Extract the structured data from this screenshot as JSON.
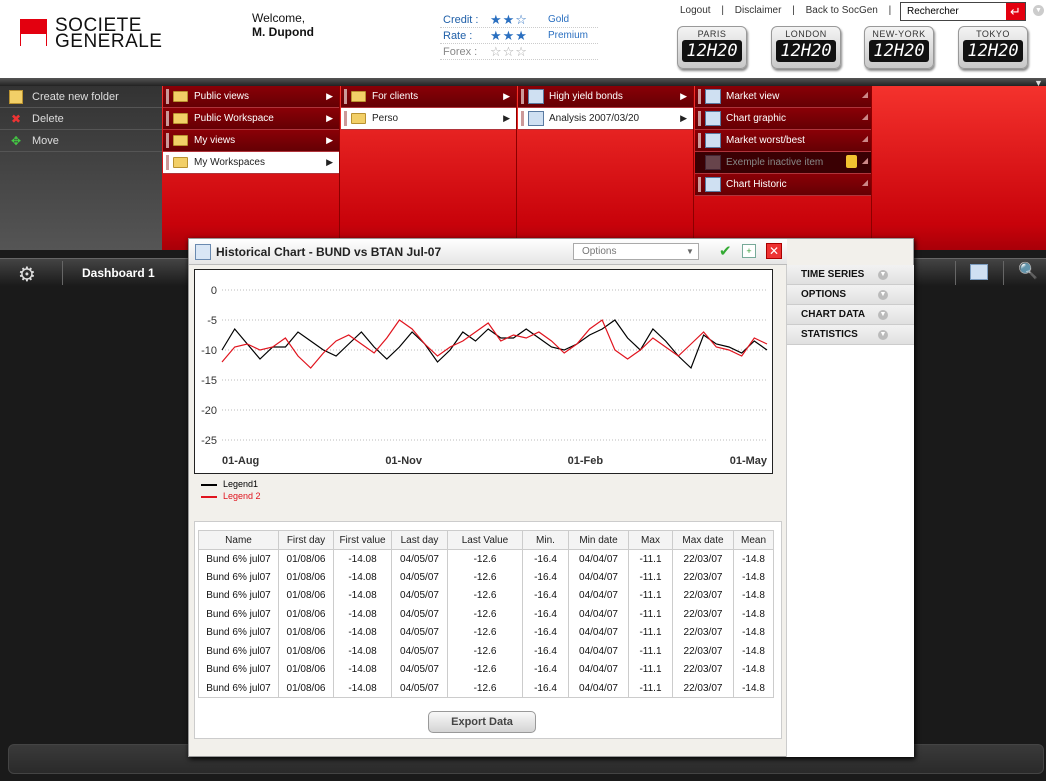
{
  "header": {
    "brand_line1": "SOCIETE",
    "brand_line2": "GENERALE",
    "welcome": "Welcome,",
    "user": "M. Dupond",
    "ratings": [
      {
        "label": "Credit :",
        "stars": "★★☆",
        "level": "Gold"
      },
      {
        "label": "Rate :",
        "stars": "★★★",
        "level": "Premium"
      },
      {
        "label": "Forex :",
        "stars": "☆☆☆",
        "level": ""
      }
    ],
    "links": [
      "Logout",
      "|",
      "Disclaimer",
      "|",
      "Back to SocGen",
      "|"
    ],
    "search_value": "Rechercher",
    "clocks": [
      {
        "city": "PARIS",
        "time": "12H20"
      },
      {
        "city": "LONDON",
        "time": "12H20"
      },
      {
        "city": "NEW-YORK",
        "time": "12H20"
      },
      {
        "city": "TOKYO",
        "time": "12H20"
      }
    ]
  },
  "actions": [
    {
      "label": "Create new folder",
      "icon": "new-folder-icon"
    },
    {
      "label": "Delete",
      "icon": "delete-icon"
    },
    {
      "label": "Move",
      "icon": "move-icon"
    }
  ],
  "menu": {
    "col1": [
      "Public views",
      "Public Workspace",
      "My views",
      "My Workspaces"
    ],
    "col2": [
      "For clients",
      "Perso"
    ],
    "col3": [
      "High yield bonds",
      "Analysis 2007/03/20"
    ],
    "col4": [
      "Market view",
      "Chart graphic",
      "Market worst/best",
      "Exemple inactive item",
      "Chart Historic"
    ]
  },
  "toolbar": {
    "dashboard": "Dashboard 1"
  },
  "window": {
    "title": "Historical Chart - BUND vs BTAN Jul-07",
    "options_label": "Options",
    "export_label": "Export Data",
    "side": [
      "TIME SERIES",
      "OPTIONS",
      "CHART DATA",
      "STATISTICS"
    ]
  },
  "chart_data": {
    "type": "line",
    "x_ticks": [
      "01-Aug",
      "01-Nov",
      "01-Feb",
      "01-May"
    ],
    "ylim": [
      -27,
      2
    ],
    "y_ticks": [
      0,
      -5,
      -10,
      -15,
      -20,
      -25
    ],
    "grid": "horizontal-dotted",
    "legend_position": "below",
    "series": [
      {
        "name": "Legend1",
        "color": "#000000",
        "values": [
          -10,
          -6.5,
          -9,
          -11.5,
          -9.5,
          -9.5,
          -7,
          -8.5,
          -10,
          -11,
          -9,
          -7,
          -9.5,
          -11.5,
          -9.5,
          -7,
          -9,
          -12,
          -10,
          -7,
          -8.5,
          -6.5,
          -8,
          -8,
          -6.5,
          -8,
          -9.5,
          -10,
          -9,
          -7.5,
          -6.5,
          -5,
          -8,
          -10,
          -6.5,
          -8.5,
          -11,
          -13,
          -7.5,
          -9,
          -9.5,
          -10.5,
          -8.5,
          -10
        ]
      },
      {
        "name": "Legend 2",
        "color": "#e0141e",
        "values": [
          -12,
          -9.5,
          -9,
          -10,
          -9.5,
          -8,
          -11,
          -13,
          -10.5,
          -8.5,
          -7.5,
          -9,
          -10.5,
          -8,
          -5,
          -6.5,
          -9,
          -11,
          -9.5,
          -8.5,
          -7,
          -5.5,
          -8.5,
          -7.5,
          -8,
          -7,
          -8.5,
          -10.5,
          -9,
          -6.5,
          -5,
          -10,
          -11.5,
          -10,
          -8,
          -9.5,
          -11,
          -9,
          -7,
          -9.5,
          -10,
          -11,
          -8,
          -9
        ]
      }
    ]
  },
  "table": {
    "headers": [
      "Name",
      "First day",
      "First value",
      "Last day",
      "Last Value",
      "Min.",
      "Min date",
      "Max",
      "Max date",
      "Mean"
    ],
    "rows": [
      [
        "Bund 6% jul07",
        "01/08/06",
        "-14.08",
        "04/05/07",
        "-12.6",
        "-16.4",
        "04/04/07",
        "-11.1",
        "22/03/07",
        "-14.8"
      ],
      [
        "Bund 6% jul07",
        "01/08/06",
        "-14.08",
        "04/05/07",
        "-12.6",
        "-16.4",
        "04/04/07",
        "-11.1",
        "22/03/07",
        "-14.8"
      ],
      [
        "Bund 6% jul07",
        "01/08/06",
        "-14.08",
        "04/05/07",
        "-12.6",
        "-16.4",
        "04/04/07",
        "-11.1",
        "22/03/07",
        "-14.8"
      ],
      [
        "Bund 6% jul07",
        "01/08/06",
        "-14.08",
        "04/05/07",
        "-12.6",
        "-16.4",
        "04/04/07",
        "-11.1",
        "22/03/07",
        "-14.8"
      ],
      [
        "Bund 6% jul07",
        "01/08/06",
        "-14.08",
        "04/05/07",
        "-12.6",
        "-16.4",
        "04/04/07",
        "-11.1",
        "22/03/07",
        "-14.8"
      ],
      [
        "Bund 6% jul07",
        "01/08/06",
        "-14.08",
        "04/05/07",
        "-12.6",
        "-16.4",
        "04/04/07",
        "-11.1",
        "22/03/07",
        "-14.8"
      ],
      [
        "Bund 6% jul07",
        "01/08/06",
        "-14.08",
        "04/05/07",
        "-12.6",
        "-16.4",
        "04/04/07",
        "-11.1",
        "22/03/07",
        "-14.8"
      ],
      [
        "Bund 6% jul07",
        "01/08/06",
        "-14.08",
        "04/05/07",
        "-12.6",
        "-16.4",
        "04/04/07",
        "-11.1",
        "22/03/07",
        "-14.8"
      ]
    ]
  }
}
